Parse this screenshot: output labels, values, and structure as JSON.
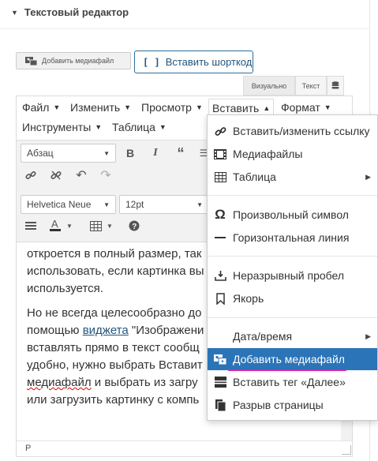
{
  "panel": {
    "title": "Текстовый редактор"
  },
  "media_buttons": {
    "add_media_label": "Добавить медиафайл",
    "insert_shortcode_label": "Вставить шорткод"
  },
  "mode_tabs": {
    "visual": "Визуально",
    "text": "Текст"
  },
  "menubar": {
    "file": "Файл",
    "edit": "Изменить",
    "view": "Просмотр",
    "insert": "Вставить",
    "format": "Формат",
    "tools": "Инструменты",
    "table": "Таблица"
  },
  "toolbar": {
    "block_format": "Абзац",
    "font_family": "Helvetica Neue",
    "font_size": "12pt"
  },
  "content": {
    "lines": [
      "откроется в полный размер, так",
      "использовать, если картинка вы",
      "используется.",
      "Но не всегда целесообразно до",
      "помощью ",
      "виджета",
      " \"Изображени",
      "вставлять прямо в текст сообщ",
      "удобно, нужно выбрать Вставит",
      "медиафайл",
      " и выбрать из загру",
      "или загрузить картинку с компь"
    ]
  },
  "status_bar": {
    "path": "P"
  },
  "insert_menu": {
    "items": [
      {
        "icon": "link-icon",
        "label": "Вставить/изменить ссылку"
      },
      {
        "icon": "film-icon",
        "label": "Медиафайлы"
      },
      {
        "icon": "table-icon",
        "label": "Таблица"
      },
      {
        "icon": "omega-icon",
        "label": "Произвольный символ"
      },
      {
        "icon": "horizontal-line-icon",
        "label": "Горизонтальная линия"
      },
      {
        "icon": "nbsp-icon",
        "label": "Неразрывный пробел"
      },
      {
        "icon": "bookmark-icon",
        "label": "Якорь"
      },
      {
        "icon": "",
        "label": "Дата/время"
      },
      {
        "icon": "add-media-icon",
        "label": "Добавить медиафайл"
      },
      {
        "icon": "more-tag-icon",
        "label": "Вставить тег «Далее»"
      },
      {
        "icon": "page-break-icon",
        "label": "Разрыв страницы"
      }
    ]
  },
  "colors": {
    "accent": "#2b74b7",
    "highlight_underline": "#e11fb0",
    "toolbar_bg": "#f2f2f2"
  }
}
